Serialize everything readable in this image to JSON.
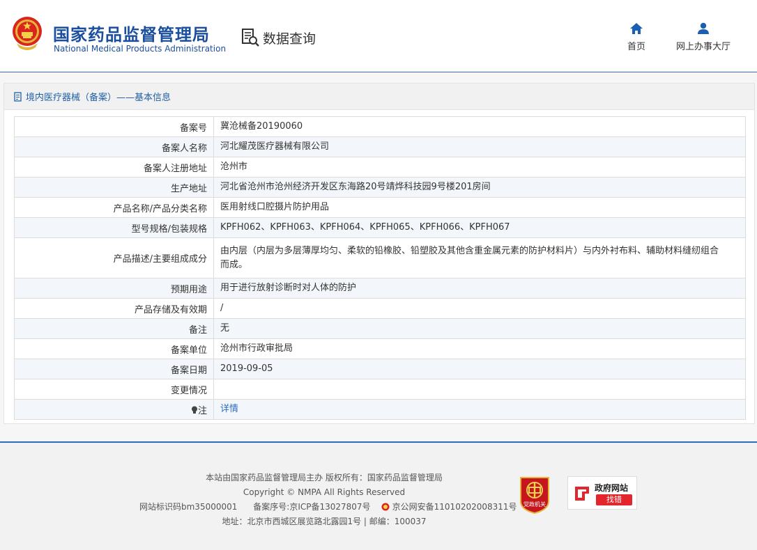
{
  "header": {
    "logo_cn": "国家药品监督管理局",
    "logo_en": "National Medical Products Administration",
    "query_label": "数据查询",
    "nav": [
      {
        "label": "首页",
        "icon": "home-icon"
      },
      {
        "label": "网上办事大厅",
        "icon": "user-icon"
      }
    ]
  },
  "panel": {
    "title": "境内医疗器械（备案）——基本信息",
    "rows": [
      {
        "key": "备案号",
        "value": "冀沧械备20190060"
      },
      {
        "key": "备案人名称",
        "value": "河北耀茂医疗器械有限公司"
      },
      {
        "key": "备案人注册地址",
        "value": "沧州市"
      },
      {
        "key": "生产地址",
        "value": "河北省沧州市沧州经济开发区东海路20号靖烨科技园9号楼201房间"
      },
      {
        "key": "产品名称/产品分类名称",
        "value": "医用射线口腔摄片防护用品"
      },
      {
        "key": "型号规格/包装规格",
        "value": "KPFH062、KPFH063、KPFH064、KPFH065、KPFH066、KPFH067"
      },
      {
        "key": "产品描述/主要组成成分",
        "value": "由内层（内层为多层薄厚均匀、柔软的铅橡胶、铅塑胶及其他含重金属元素的防护材料片）与内外衬布料、辅助材料缝纫组合而成。"
      },
      {
        "key": "预期用途",
        "value": "用于进行放射诊断时对人体的防护"
      },
      {
        "key": "产品存储及有效期",
        "value": "/"
      },
      {
        "key": "备注",
        "value": "无"
      },
      {
        "key": "备案单位",
        "value": "沧州市行政审批局"
      },
      {
        "key": "备案日期",
        "value": "2019-09-05"
      },
      {
        "key": "变更情况",
        "value": ""
      },
      {
        "key": "注",
        "value": "详情"
      }
    ]
  },
  "footer": {
    "line1": "本站由国家药品监督管理局主办 版权所有：国家药品监督管理局",
    "line2": "Copyright © NMPA All Rights Reserved",
    "site_id": "网站标识码bm35000001",
    "icp": "备案序号:京ICP备13027807号",
    "police": "京公网安备11010202008311号",
    "address": "地址：北京市西城区展览路北露园1号 | 邮编：100037",
    "badge_text": "党政机关",
    "gov_error_title": "政府网站",
    "gov_error_button": "找错"
  },
  "colors": {
    "brand_blue": "#1a4e9e",
    "link_blue": "#2c6dbf",
    "red": "#e3262c"
  }
}
